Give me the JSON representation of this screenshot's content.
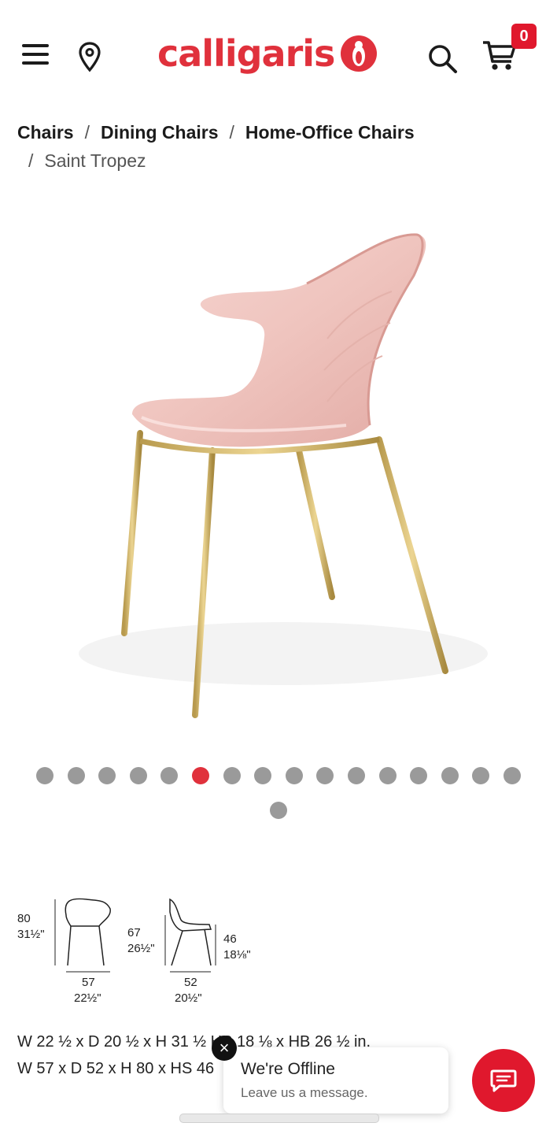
{
  "header": {
    "logo_text": "calligaris",
    "cart_count": "0",
    "brand_color": "#e0313c",
    "icons": [
      "menu-icon",
      "location-pin-icon",
      "search-icon",
      "cart-icon"
    ]
  },
  "breadcrumb": {
    "links": [
      "Chairs",
      "Dining Chairs",
      "Home-Office Chairs"
    ],
    "separator": "/",
    "current": "Saint Tropez"
  },
  "gallery": {
    "total_dots": 17,
    "active_index": 5
  },
  "dimensions": {
    "height_cm": "80",
    "height_in": "31½\"",
    "width_cm": "57",
    "width_in": "22½\"",
    "armrest_cm": "67",
    "armrest_in": "26½\"",
    "depth_cm": "52",
    "depth_in": "20½\"",
    "seat_cm": "46",
    "seat_in": "18⅛\""
  },
  "specs": {
    "inches": "W 22 ½ x D 20 ½ x H 31 ½ HS 18 ⅛ x HB 26 ½ in.",
    "cm": "W 57 x D 52 x H 80 x HS 46"
  },
  "chat": {
    "title": "We're Offline",
    "subtitle": "Leave us a message.",
    "close_glyph": "×"
  }
}
